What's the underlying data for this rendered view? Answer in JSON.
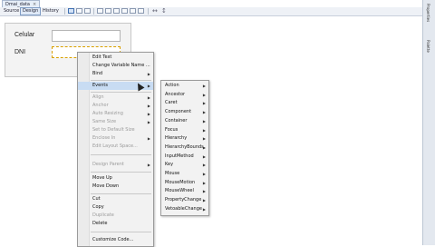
{
  "file_tab": {
    "title": "Dmai_data",
    "close": "×"
  },
  "toolbar": {
    "tabs": [
      "Source",
      "Design",
      "History"
    ],
    "selected_tab": "Design"
  },
  "right_panel": {
    "tabs": [
      "Properties",
      "Palette"
    ]
  },
  "form": {
    "labels": {
      "celular": "Celular",
      "dni": "DNI"
    }
  },
  "context_menu": {
    "items": [
      {
        "label": "Edit Text",
        "enabled": true,
        "submenu": false
      },
      {
        "label": "Change Variable Name ...",
        "enabled": true,
        "submenu": false
      },
      {
        "label": "Bind",
        "enabled": true,
        "submenu": true
      },
      {
        "label": "Events",
        "enabled": true,
        "submenu": true,
        "highlighted": true
      },
      {
        "label": "Align",
        "enabled": false,
        "submenu": true
      },
      {
        "label": "Anchor",
        "enabled": false,
        "submenu": true
      },
      {
        "label": "Auto Resizing",
        "enabled": false,
        "submenu": true
      },
      {
        "label": "Same Size",
        "enabled": false,
        "submenu": true
      },
      {
        "label": "Set to Default Size",
        "enabled": false,
        "submenu": false
      },
      {
        "label": "Enclose In",
        "enabled": false,
        "submenu": true
      },
      {
        "label": "Edit Layout Space...",
        "enabled": false,
        "submenu": false
      },
      {
        "label": "Design Parent",
        "enabled": false,
        "submenu": true
      },
      {
        "label": "Move Up",
        "enabled": true,
        "submenu": false
      },
      {
        "label": "Move Down",
        "enabled": true,
        "submenu": false
      },
      {
        "label": "Cut",
        "enabled": true,
        "submenu": false
      },
      {
        "label": "Copy",
        "enabled": true,
        "submenu": false
      },
      {
        "label": "Duplicate",
        "enabled": false,
        "submenu": false
      },
      {
        "label": "Delete",
        "enabled": true,
        "submenu": false
      },
      {
        "label": "Customize Code...",
        "enabled": true,
        "submenu": false
      }
    ]
  },
  "events_submenu": {
    "items": [
      "Action",
      "Ancestor",
      "Caret",
      "Component",
      "Container",
      "Focus",
      "Hierarchy",
      "HierarchyBounds",
      "InputMethod",
      "Key",
      "Mouse",
      "MouseMotion",
      "MouseWheel",
      "PropertyChange",
      "VetoableChange"
    ]
  }
}
